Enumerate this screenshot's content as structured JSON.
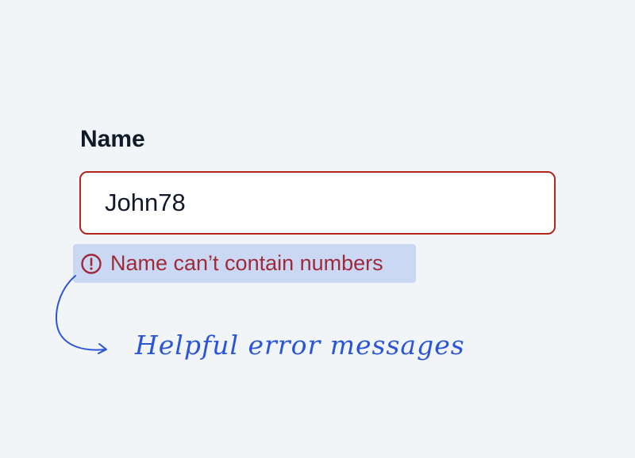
{
  "form": {
    "label": "Name",
    "input_value": "John78",
    "error_text": "Name can’t contain numbers"
  },
  "annotation": {
    "text": "Helpful error messages"
  },
  "icons": {
    "error": "exclamation-circle-icon",
    "annotation_arrow": "curved-arrow-icon"
  },
  "colors": {
    "background": "#f2f5f8",
    "error": "#b3261e",
    "error_text": "#9e2a3a",
    "error_highlight": "#cbd8f4",
    "annotation": "#2a55d9"
  }
}
